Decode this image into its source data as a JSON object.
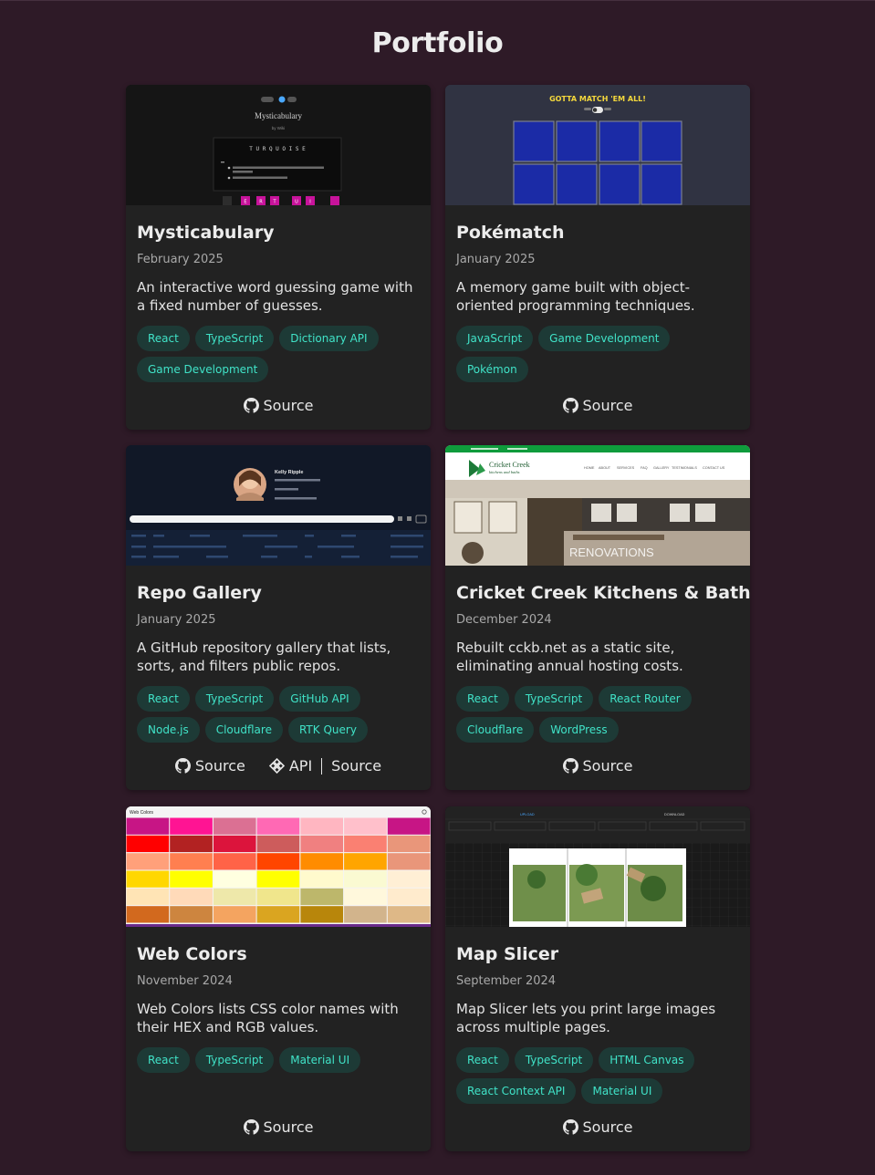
{
  "page": {
    "title": "Portfolio"
  },
  "projects": [
    {
      "title": "Mysticabulary",
      "date": "February 2025",
      "description": "An interactive word guessing game with a fixed number of guesses.",
      "tags": [
        "React",
        "TypeScript",
        "Dictionary API",
        "Game Development"
      ],
      "links": [
        "Source"
      ],
      "thumb": {
        "heading": "Mysticabulary",
        "subheading": "by Wiki",
        "word": "T U R Q U O I S E",
        "keys": [
          "E",
          "R",
          "T",
          "U",
          "I"
        ]
      }
    },
    {
      "title": "Pokématch",
      "date": "January 2025",
      "description": "A memory game built with object-oriented programming techniques.",
      "tags": [
        "JavaScript",
        "Game Development",
        "Pokémon"
      ],
      "links": [
        "Source"
      ],
      "thumb": {
        "heading": "GOTTA MATCH 'EM ALL!"
      }
    },
    {
      "title": "Repo Gallery",
      "date": "January 2025",
      "description": "A GitHub repository gallery that lists, sorts, and filters public repos.",
      "tags": [
        "React",
        "TypeScript",
        "GitHub API",
        "Node.js",
        "Cloudflare",
        "RTK Query"
      ],
      "links": [
        "Source",
        "API",
        "Source"
      ],
      "thumb": {
        "name": "Kelly Ripple"
      }
    },
    {
      "title": "Cricket Creek Kitchens & Baths",
      "date": "December 2024",
      "description": "Rebuilt cckb.net as a static site, eliminating annual hosting costs.",
      "tags": [
        "React",
        "TypeScript",
        "React Router",
        "Cloudflare",
        "WordPress"
      ],
      "links": [
        "Source"
      ],
      "thumb": {
        "brand": "Cricket Creek",
        "brand_sub": "kitchens and baths",
        "nav": [
          "HOME",
          "ABOUT",
          "SERVICES",
          "FAQ",
          "GALLERY",
          "TESTIMONIALS",
          "CONTACT US"
        ],
        "overlay": "RENOVATIONS"
      }
    },
    {
      "title": "Web Colors",
      "date": "November 2024",
      "description": "Web Colors lists CSS color names with their HEX and RGB values.",
      "tags": [
        "React",
        "TypeScript",
        "Material UI"
      ],
      "links": [
        "Source"
      ],
      "thumb": {
        "heading": "Web Colors",
        "swatches": [
          [
            "#c71585",
            "#ff1493",
            "#db7093",
            "#ff69b4",
            "#ffb6c1",
            "#ffc0cb",
            "#c71585"
          ],
          [
            "#ff0000",
            "#b22222",
            "#dc143c",
            "#cd5c5c",
            "#f08080",
            "#fa8072",
            "#e9967a"
          ],
          [
            "#ffa07a",
            "#ff7f50",
            "#ff6347",
            "#ff4500",
            "#ff8c00",
            "#ffa500",
            "#e9967a"
          ],
          [
            "#ffd700",
            "#ffff00",
            "#ffffe0",
            "#ffff00",
            "#fffacd",
            "#fafad2",
            "#ffefd5"
          ],
          [
            "#ffe4b5",
            "#ffdab9",
            "#eee8aa",
            "#f0e68c",
            "#bdb76b",
            "#fff8dc",
            "#ffebcd"
          ],
          [
            "#d2691e",
            "#cd853f",
            "#f4a460",
            "#daa520",
            "#b8860b",
            "#d2b48c",
            "#deb887"
          ]
        ]
      }
    },
    {
      "title": "Map Slicer",
      "date": "September 2024",
      "description": "Map Slicer lets you print large images across multiple pages.",
      "tags": [
        "React",
        "TypeScript",
        "HTML Canvas",
        "React Context API",
        "Material UI"
      ],
      "links": [
        "Source"
      ],
      "thumb": {
        "upload": "UPLOAD",
        "download": "DOWNLOAD"
      }
    }
  ]
}
